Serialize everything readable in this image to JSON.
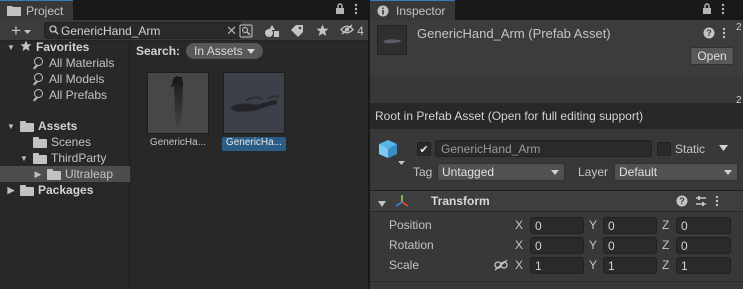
{
  "project": {
    "tab_label": "Project",
    "tab_icon": "folder-icon",
    "add_label": "+",
    "search_value": "GenericHand_Arm",
    "hidden_count": "4",
    "tree": {
      "favorites": "Favorites",
      "all_materials": "All Materials",
      "all_models": "All Models",
      "all_prefabs": "All Prefabs",
      "assets": "Assets",
      "scenes": "Scenes",
      "third_party": "ThirdParty",
      "ultraleap": "Ultraleap",
      "packages": "Packages"
    },
    "search_label": "Search:",
    "search_scope": "In Assets",
    "items": [
      {
        "name": "GenericHa...",
        "selected": false
      },
      {
        "name": "GenericHa...",
        "selected": true
      }
    ]
  },
  "inspector": {
    "tab_label": "Inspector",
    "title": "GenericHand_Arm (Prefab Asset)",
    "open_label": "Open",
    "root_note": "Root in Prefab Asset (Open for full editing support)",
    "object_name": "GenericHand_Arm",
    "static_label": "Static",
    "tag_label": "Tag",
    "tag_value": "Untagged",
    "layer_label": "Layer",
    "layer_value": "Default",
    "transform": {
      "title": "Transform",
      "rows": [
        {
          "label": "Position",
          "x": "0",
          "y": "0",
          "z": "0"
        },
        {
          "label": "Rotation",
          "x": "0",
          "y": "0",
          "z": "0"
        },
        {
          "label": "Scale",
          "x": "1",
          "y": "1",
          "z": "1"
        }
      ]
    }
  },
  "axes": {
    "x": "X",
    "y": "Y",
    "z": "Z"
  },
  "edge_glyphs": [
    "2",
    "2"
  ],
  "colors": {
    "selection": "#2c5d87",
    "tab_accent": "#3a79bb",
    "cube": "#55b4e8"
  }
}
